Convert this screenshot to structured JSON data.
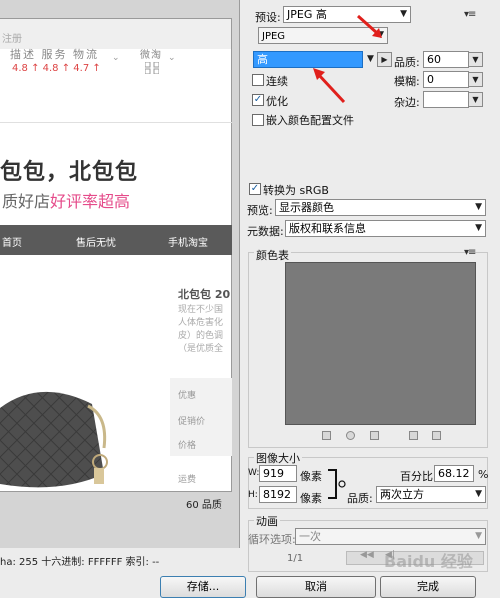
{
  "preview": {
    "reg_text": "注册",
    "service_title": "描述 服务 物流",
    "service_scores": "4.8 ↑  4.8 ↑  4.7 ↑",
    "weitao_label": "微淘",
    "store_name": "包包，北包包",
    "slogan_prefix": "质好店",
    "slogan_highlight": "好评率超高",
    "nav": [
      "首页",
      "售后无忧",
      "手机淘宝"
    ],
    "product_title": "北包包 20",
    "product_desc": [
      "现在不少国",
      "人体危害化",
      "皮）的色调",
      "（是优质全"
    ],
    "price_labels": [
      "优惠",
      "促销价",
      "价格"
    ],
    "freight_label": "运费",
    "quality_footer": "60 品质",
    "status": "ha: 255   十六进制: FFFFFF   索引: --"
  },
  "settings": {
    "preset_label": "预设:",
    "preset_value": "JPEG 高",
    "format_value": "JPEG",
    "quality_level": "高",
    "quality_label": "品质:",
    "quality_value": "60",
    "progressive_label": "连续",
    "progressive_checked": false,
    "blur_label": "模糊:",
    "blur_value": "0",
    "optimized_label": "优化",
    "optimized_checked": true,
    "matte_label": "杂边:",
    "embed_profile_label": "嵌入颜色配置文件",
    "embed_profile_checked": false,
    "convert_srgb_label": "转换为 sRGB",
    "convert_srgb_checked": true,
    "preview_label": "预览:",
    "preview_value": "显示器颜色",
    "metadata_label": "元数据:",
    "metadata_value": "版权和联系信息"
  },
  "color_table": {
    "title": "颜色表",
    "swatch_color": "#7a7a7a"
  },
  "image_size": {
    "title": "图像大小",
    "w_label": "W:",
    "w_value": "919",
    "h_label": "H:",
    "h_value": "8192",
    "unit": "像素",
    "percent_label": "百分比:",
    "percent_value": "68.12",
    "percent_unit": "%",
    "quality_label": "品质:",
    "quality_value": "两次立方"
  },
  "animation": {
    "title": "动画",
    "loop_label": "循环选项:",
    "loop_value": "一次",
    "frame_counter": "1/1"
  },
  "buttons": {
    "save": "存储...",
    "cancel": "取消",
    "done": "完成"
  },
  "watermark": "Baidu 经验",
  "colors": {
    "annotation_red": "#e0201c",
    "selection_blue": "#3399ff",
    "pink_accent": "#e54b8a"
  }
}
